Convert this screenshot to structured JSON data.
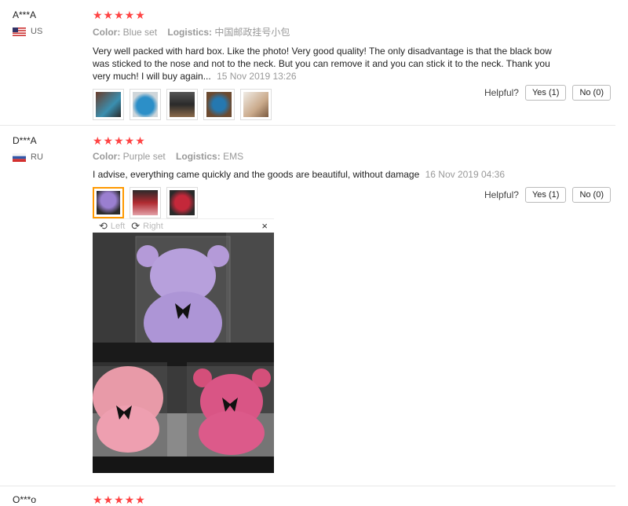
{
  "reviews": [
    {
      "user": "A***A",
      "country": "US",
      "stars": "★★★★★",
      "color_label": "Color:",
      "color_value": "Blue set",
      "logistics_label": "Logistics:",
      "logistics_value": "中国邮政挂号小包",
      "text": "Very well packed with hard box. Like the photo! Very good quality! The only disadvantage is that the black bow was sticked to the nose and not to the neck. But you can remove it and you can stick it to the neck. Thank you very much! I will buy again...",
      "date": "15 Nov 2019 13:26",
      "helpful_label": "Helpful?",
      "yes_label": "Yes (1)",
      "no_label": "No (0)"
    },
    {
      "user": "D***A",
      "country": "RU",
      "stars": "★★★★★",
      "color_label": "Color:",
      "color_value": "Purple set",
      "logistics_label": "Logistics:",
      "logistics_value": "EMS",
      "text": "I advise, everything came quickly and the goods are beautiful, without damage",
      "date": "16 Nov 2019 04:36",
      "helpful_label": "Helpful?",
      "yes_label": "Yes (1)",
      "no_label": "No (0)"
    },
    {
      "user": "O***o",
      "stars": "★★★★★"
    }
  ],
  "viewer": {
    "left_label": "Left",
    "right_label": "Right",
    "close": "×"
  },
  "colors": {
    "star": "#ff4747",
    "accent_border": "#ff9900"
  }
}
